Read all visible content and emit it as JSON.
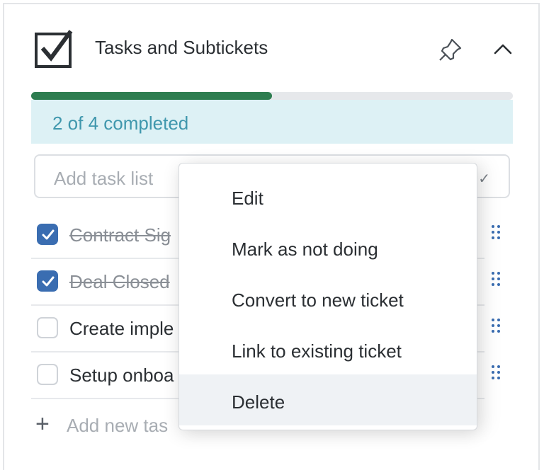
{
  "card": {
    "title": "Tasks and Subtickets",
    "icons": {
      "header": "checkbox-icon",
      "pin": "pin-icon",
      "collapse": "chevron-up-icon"
    }
  },
  "progress": {
    "text": "2 of 4 completed",
    "completed": 2,
    "total": 4,
    "fraction": 0.5,
    "bar_color": "#2e7d50"
  },
  "add_task_list": {
    "placeholder": "Add task list",
    "confirm_icon": "check-icon"
  },
  "tasks": [
    {
      "label": "Contract Sig",
      "checked": true
    },
    {
      "label": "Deal Closed",
      "checked": true
    },
    {
      "label": "Create imple",
      "checked": false
    },
    {
      "label": "Setup onboa",
      "checked": false
    }
  ],
  "add_new_task": {
    "label": "Add new tas",
    "icon": "plus-icon"
  },
  "context_menu": {
    "items": [
      {
        "label": "Edit"
      },
      {
        "label": "Mark as not doing"
      },
      {
        "label": "Convert to new ticket"
      },
      {
        "label": "Link to existing ticket"
      },
      {
        "label": "Delete",
        "highlighted": true
      }
    ]
  },
  "colors": {
    "accent": "#3a6db1",
    "progress_bg": "#ddf1f5",
    "progress_text": "#3f97ad"
  }
}
